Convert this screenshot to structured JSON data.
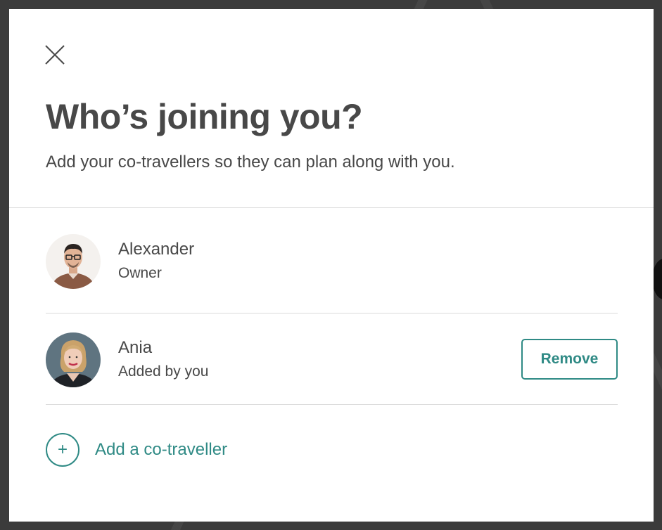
{
  "modal": {
    "title": "Who’s joining you?",
    "subtitle": "Add your co-travellers so they can plan along with you."
  },
  "travellers": [
    {
      "name": "Alexander",
      "role": "Owner",
      "avatar": "avatar-man-photo"
    },
    {
      "name": "Ania",
      "role": "Added by you",
      "avatar": "avatar-woman-photo",
      "action_label": "Remove"
    }
  ],
  "add_traveller": {
    "icon": "plus-icon",
    "plus_glyph": "+",
    "label": "Add a co-traveller"
  },
  "icons": {
    "close": "close-icon"
  },
  "colors": {
    "accent": "#2f8a85",
    "text": "#484848",
    "divider": "#dcdcdc"
  }
}
